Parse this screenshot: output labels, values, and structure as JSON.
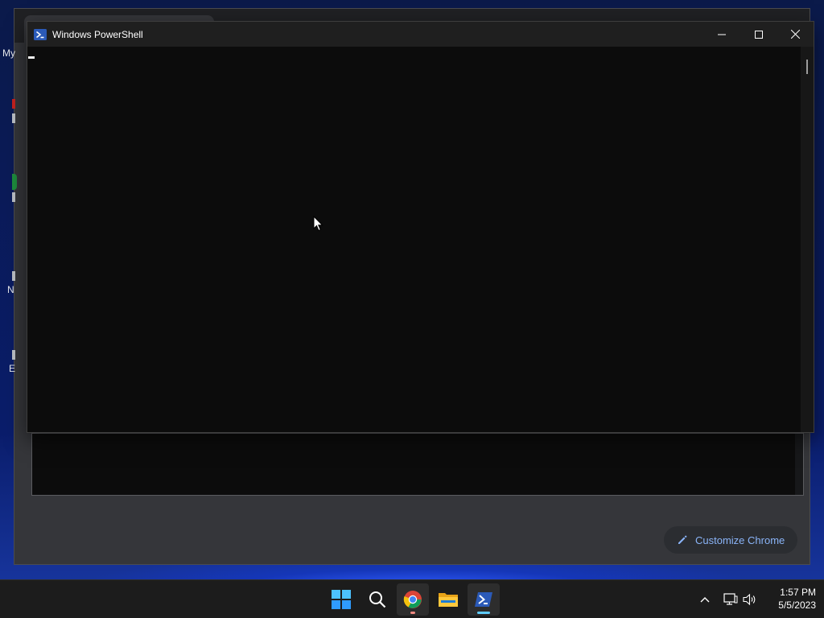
{
  "powershell": {
    "title": "Windows PowerShell",
    "controls": [
      "minimize-icon",
      "maximize-icon",
      "close-icon"
    ],
    "accent": "#0c0c0c"
  },
  "chrome": {
    "partial_labels": [
      "My",
      "N",
      "E"
    ],
    "customize_button": "Customize Chrome",
    "accent": "#8ab4f8"
  },
  "taskbar": {
    "apps": [
      {
        "name": "start-icon"
      },
      {
        "name": "search-icon"
      },
      {
        "name": "chrome-icon",
        "indicator_color": "#f28b82"
      },
      {
        "name": "file-explorer-icon"
      },
      {
        "name": "powershell-icon",
        "indicator_color": "#60cdff"
      }
    ],
    "tray": [
      "chevron-up-icon",
      "network-icon",
      "volume-icon"
    ],
    "time": "1:57 PM",
    "date": "5/5/2023"
  }
}
